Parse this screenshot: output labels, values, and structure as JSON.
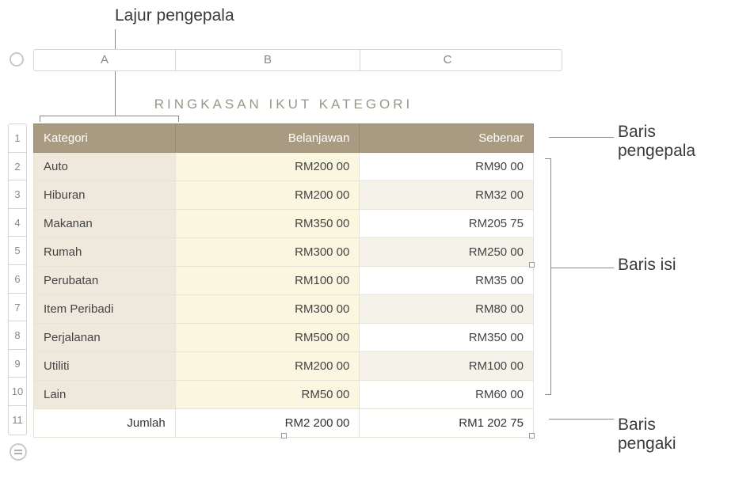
{
  "callouts": {
    "top": "Lajur pengepala",
    "right1": "Baris\npengepala",
    "right2": "Baris isi",
    "right3": "Baris\npengaki"
  },
  "columns": {
    "A": "A",
    "B": "B",
    "C": "C"
  },
  "rownums": [
    "1",
    "2",
    "3",
    "4",
    "5",
    "6",
    "7",
    "8",
    "9",
    "10",
    "11"
  ],
  "table": {
    "title": "RINGKASAN IKUT KATEGORI",
    "headers": {
      "cat": "Kategori",
      "bud": "Belanjawan",
      "act": "Sebenar"
    },
    "rows": [
      {
        "cat": "Auto",
        "bud": "RM200 00",
        "act": "RM90 00"
      },
      {
        "cat": "Hiburan",
        "bud": "RM200 00",
        "act": "RM32 00"
      },
      {
        "cat": "Makanan",
        "bud": "RM350 00",
        "act": "RM205 75"
      },
      {
        "cat": "Rumah",
        "bud": "RM300 00",
        "act": "RM250 00"
      },
      {
        "cat": "Perubatan",
        "bud": "RM100 00",
        "act": "RM35 00"
      },
      {
        "cat": "Item Peribadi",
        "bud": "RM300 00",
        "act": "RM80 00"
      },
      {
        "cat": "Perjalanan",
        "bud": "RM500 00",
        "act": "RM350 00"
      },
      {
        "cat": "Utiliti",
        "bud": "RM200 00",
        "act": "RM100 00"
      },
      {
        "cat": "Lain",
        "bud": "RM50 00",
        "act": "RM60 00"
      }
    ],
    "footer": {
      "cat": "Jumlah",
      "bud": "RM2 200 00",
      "act": "RM1 202 75"
    }
  }
}
